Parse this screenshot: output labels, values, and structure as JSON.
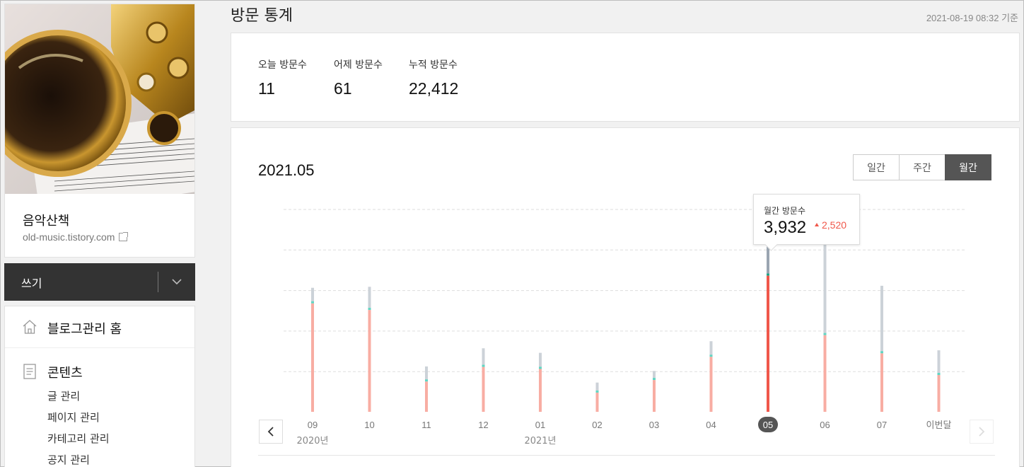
{
  "header": {
    "title": "방문 통계",
    "timestamp": "2021-08-19 08:32 기준"
  },
  "sidebar": {
    "blog_name": "음악산책",
    "blog_url": "old-music.tistory.com",
    "write_label": "쓰기",
    "home_label": "블로그관리 홈",
    "content_label": "콘텐츠",
    "content_items": [
      "글 관리",
      "페이지 관리",
      "카테고리 관리",
      "공지 관리"
    ]
  },
  "summary": {
    "stats": [
      {
        "label": "오늘 방문수",
        "value": "11"
      },
      {
        "label": "어제 방문수",
        "value": "61"
      },
      {
        "label": "누적 방문수",
        "value": "22,412"
      }
    ]
  },
  "chart_panel": {
    "period": "2021.05",
    "tabs": [
      {
        "label": "일간",
        "active": false
      },
      {
        "label": "주간",
        "active": false
      },
      {
        "label": "월간",
        "active": true
      }
    ],
    "tooltip": {
      "label": "월간 방문수",
      "value": "3,932",
      "delta": "2,520"
    }
  },
  "chart_data": {
    "type": "bar",
    "categories": [
      "09",
      "10",
      "11",
      "12",
      "01",
      "02",
      "03",
      "04",
      "05",
      "06",
      "07",
      "이번달"
    ],
    "year_labels": [
      {
        "label": "2020년",
        "category": "09"
      },
      {
        "label": "2021년",
        "category": "01"
      }
    ],
    "selected": "05",
    "series": [
      {
        "values": [
          2150,
          2020,
          600,
          890,
          850,
          380,
          630,
          1090,
          2700,
          1520,
          1160,
          730
        ]
      },
      {
        "values": [
          2460,
          2480,
          900,
          1260,
          1170,
          580,
          810,
          1400,
          3932,
          3420,
          2500,
          1220
        ]
      }
    ],
    "ylim": [
      0,
      4000
    ],
    "colors": {
      "lower": "#f8ada3",
      "lower_selected": "#f0574a",
      "upper": "#ccd2d8",
      "upper_selected": "#9aa5b1",
      "divider": "#5fd6c3",
      "divider_selected": "#1aa889",
      "grid": "#dddddd"
    }
  }
}
